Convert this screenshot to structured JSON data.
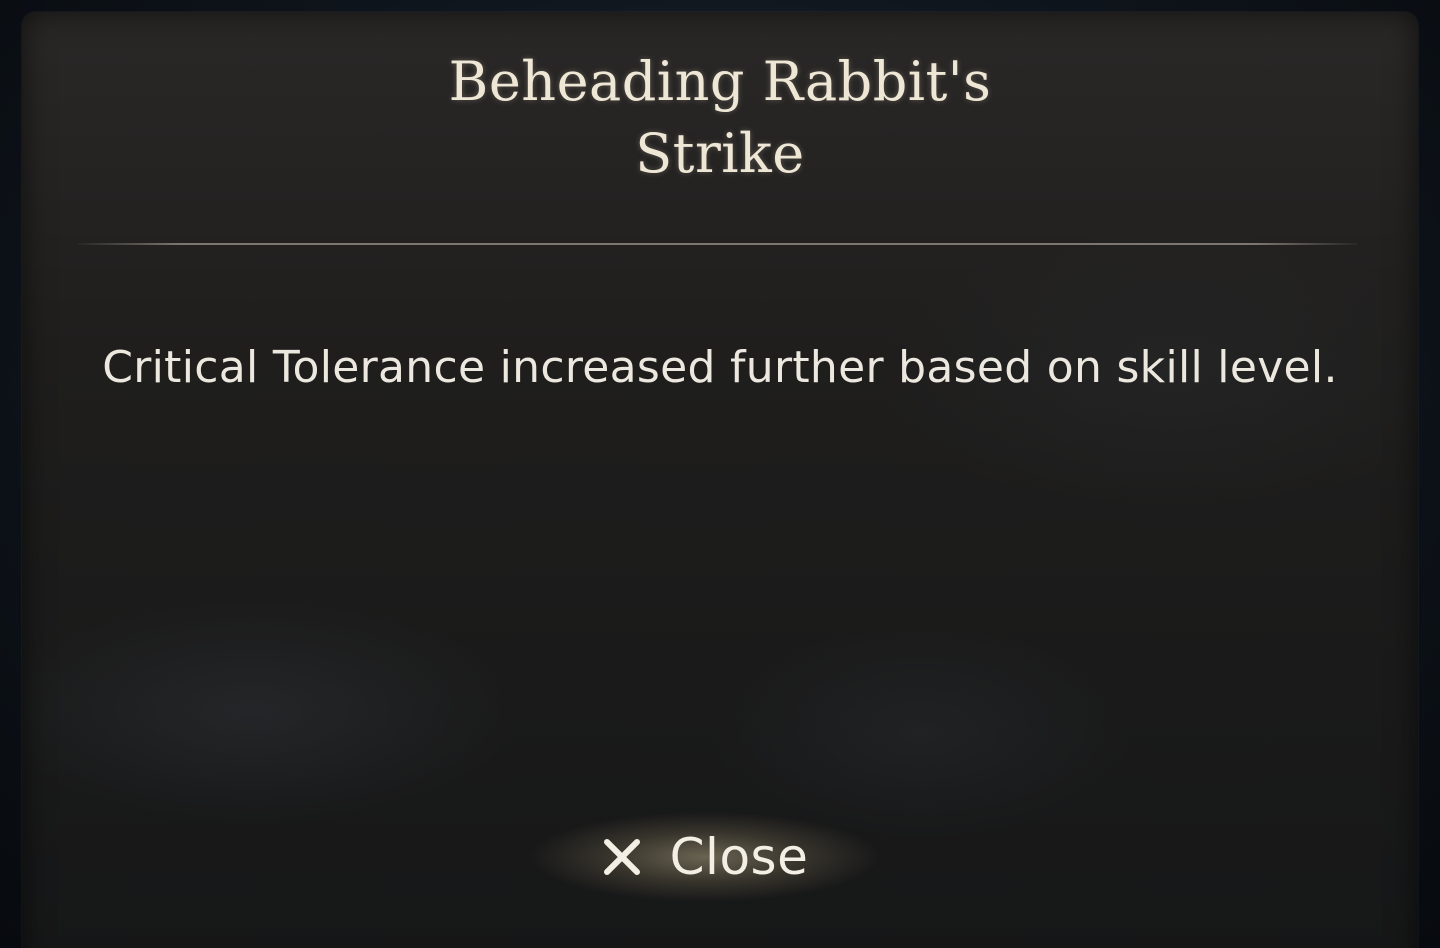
{
  "dialog": {
    "title_line1": "Beheading Rabbit's",
    "title_line2": "Strike",
    "description": "Critical Tolerance increased further based on skill level.",
    "close_label": "Close",
    "close_icon": "close-icon"
  },
  "colors": {
    "title_text": "#efe7d6",
    "body_text": "#ece8df",
    "panel_bg": "#1f1e1d",
    "button_glow": "#cdbe96"
  }
}
